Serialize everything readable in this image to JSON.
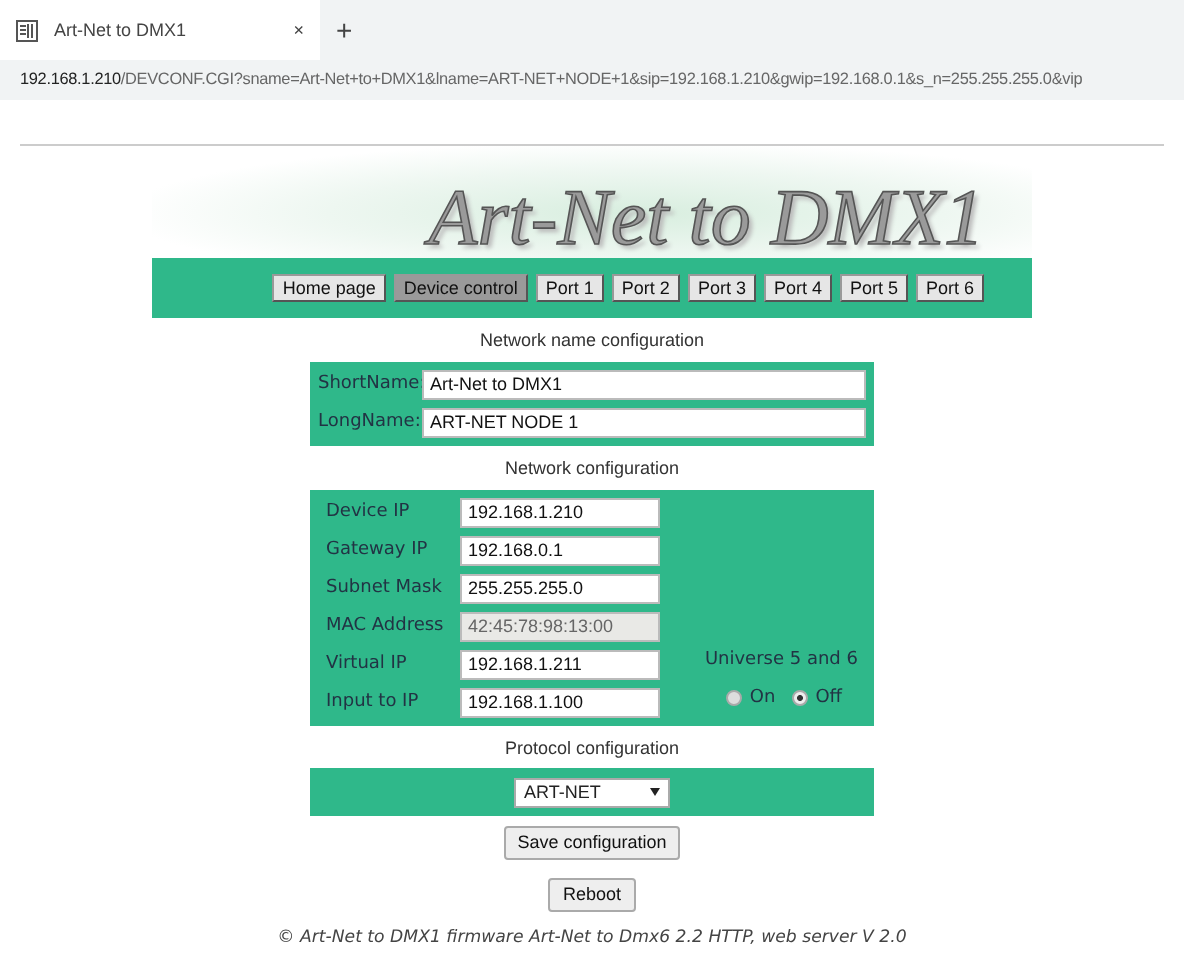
{
  "browser": {
    "tab_title": "Art-Net to DMX1",
    "new_tab": "+",
    "close": "×",
    "url_host": "192.168.1.210",
    "url_rest": "/DEVCONF.CGI?sname=Art-Net+to+DMX1&lname=ART-NET+NODE+1&sip=192.168.1.210&gwip=192.168.0.1&s_n=255.255.255.0&vip"
  },
  "header": {
    "title": "Art-Net to DMX1"
  },
  "nav": [
    {
      "label": "Home page",
      "selected": false
    },
    {
      "label": "Device control",
      "selected": true
    },
    {
      "label": "Port 1",
      "selected": false
    },
    {
      "label": "Port 2",
      "selected": false
    },
    {
      "label": "Port 3",
      "selected": false
    },
    {
      "label": "Port 4",
      "selected": false
    },
    {
      "label": "Port 5",
      "selected": false
    },
    {
      "label": "Port 6",
      "selected": false
    }
  ],
  "name_section": {
    "heading": "Network name configuration",
    "fields": [
      {
        "label": "ShortName:",
        "value": "Art-Net to DMX1"
      },
      {
        "label": "LongName:",
        "value": "ART-NET NODE 1"
      }
    ]
  },
  "network_section": {
    "heading": "Network configuration",
    "fields": [
      {
        "label": "Device IP",
        "value": "192.168.1.210",
        "disabled": false
      },
      {
        "label": "Gateway IP",
        "value": "192.168.0.1",
        "disabled": false
      },
      {
        "label": "Subnet Mask",
        "value": "255.255.255.0",
        "disabled": false
      },
      {
        "label": "MAC Address",
        "value": "42:45:78:98:13:00",
        "disabled": true
      },
      {
        "label": "Virtual IP",
        "value": "192.168.1.211",
        "disabled": false
      },
      {
        "label": "Input to IP",
        "value": "192.168.1.100",
        "disabled": false
      }
    ],
    "universe": {
      "label": "Universe 5 and 6",
      "options": [
        {
          "label": "On",
          "selected": false
        },
        {
          "label": "Off",
          "selected": true
        }
      ]
    }
  },
  "protocol_section": {
    "heading": "Protocol configuration",
    "value": "ART-NET"
  },
  "buttons": [
    "Save configuration",
    "Reboot"
  ],
  "footer": "© Art-Net to DMX1 firmware Art-Net to Dmx6 2.2 HTTP, web server V 2.0"
}
